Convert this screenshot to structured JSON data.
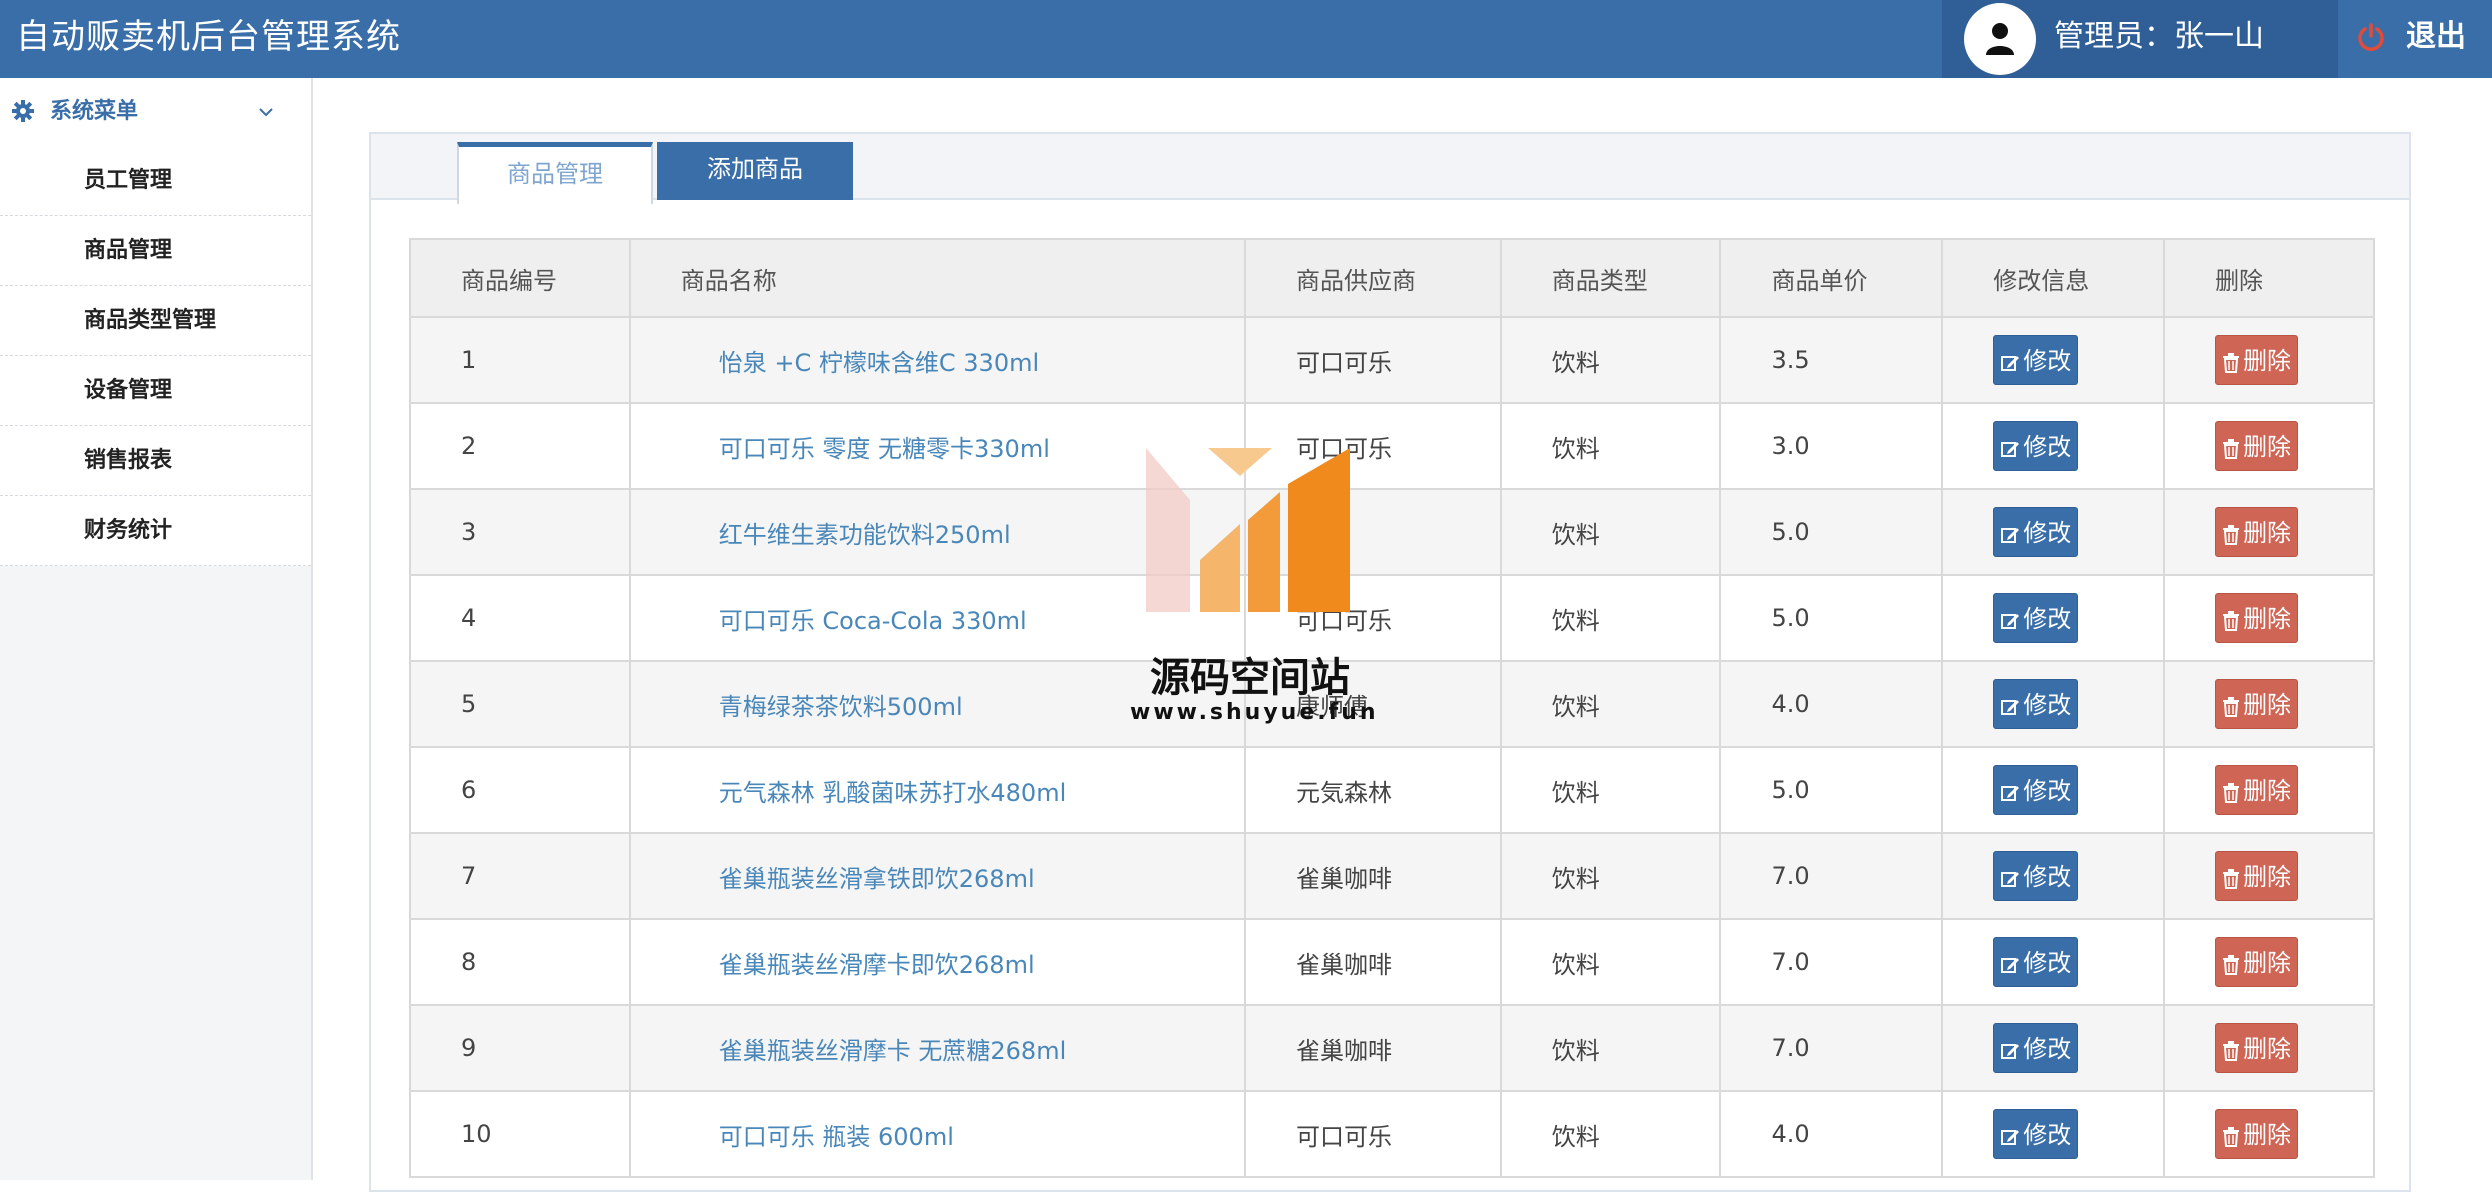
{
  "header": {
    "app_title": "自动贩卖机后台管理系统",
    "user_label": "管理员：张一山",
    "logout_label": "退出"
  },
  "sidebar": {
    "menu_title": "系统菜单",
    "items": [
      {
        "label": "员工管理"
      },
      {
        "label": "商品管理"
      },
      {
        "label": "商品类型管理"
      },
      {
        "label": "设备管理"
      },
      {
        "label": "销售报表"
      },
      {
        "label": "财务统计"
      }
    ]
  },
  "main": {
    "tabs": [
      {
        "label": "商品管理",
        "active": true
      },
      {
        "label": "添加商品",
        "active": false
      }
    ],
    "table": {
      "columns": [
        "商品编号",
        "商品名称",
        "商品供应商",
        "商品类型",
        "商品单价",
        "修改信息",
        "删除"
      ],
      "edit_label": "修改",
      "delete_label": "删除",
      "rows": [
        {
          "id": "1",
          "name": "怡泉 +C 柠檬味含维C 330ml",
          "supplier": "可口可乐",
          "type": "饮料",
          "price": "3.5"
        },
        {
          "id": "2",
          "name": "可口可乐 零度 无糖零卡330ml",
          "supplier": "可口可乐",
          "type": "饮料",
          "price": "3.0"
        },
        {
          "id": "3",
          "name": "红牛维生素功能饮料250ml",
          "supplier": "红",
          "type": "饮料",
          "price": "5.0"
        },
        {
          "id": "4",
          "name": "可口可乐 Coca-Cola 330ml",
          "supplier": "可口可乐",
          "type": "饮料",
          "price": "5.0"
        },
        {
          "id": "5",
          "name": "青梅绿茶茶饮料500ml",
          "supplier": "康师傅",
          "type": "饮料",
          "price": "4.0"
        },
        {
          "id": "6",
          "name": "元气森林 乳酸菌味苏打水480ml",
          "supplier": "元気森林",
          "type": "饮料",
          "price": "5.0"
        },
        {
          "id": "7",
          "name": "雀巢瓶装丝滑拿铁即饮268ml",
          "supplier": "雀巢咖啡",
          "type": "饮料",
          "price": "7.0"
        },
        {
          "id": "8",
          "name": "雀巢瓶装丝滑摩卡即饮268ml",
          "supplier": "雀巢咖啡",
          "type": "饮料",
          "price": "7.0"
        },
        {
          "id": "9",
          "name": "雀巢瓶装丝滑摩卡 无蔗糖268ml",
          "supplier": "雀巢咖啡",
          "type": "饮料",
          "price": "7.0"
        },
        {
          "id": "10",
          "name": "可口可乐 瓶装 600ml",
          "supplier": "可口可乐",
          "type": "饮料",
          "price": "4.0"
        }
      ]
    }
  },
  "watermark": {
    "text": "源码空间站",
    "url": "www.shuyue.fun"
  },
  "colors": {
    "brand": "#3a6ea8",
    "danger": "#cf6555",
    "link": "#4a87b9"
  }
}
